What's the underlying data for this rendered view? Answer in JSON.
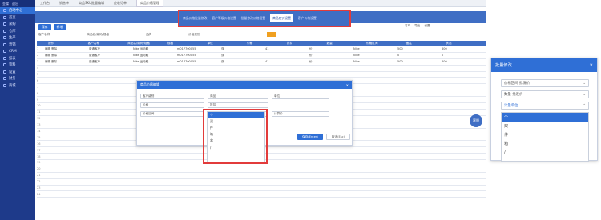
{
  "sidebar": {
    "top": [
      "金蝶",
      "退出"
    ],
    "items": [
      {
        "label": "启动中心",
        "active": true
      },
      {
        "label": "首页"
      },
      {
        "label": "采购"
      },
      {
        "label": "仓库"
      },
      {
        "label": "生产"
      },
      {
        "label": "营销"
      },
      {
        "label": "CRM"
      },
      {
        "label": "报表"
      },
      {
        "label": "资料"
      },
      {
        "label": "设置"
      },
      {
        "label": "财务"
      },
      {
        "label": "商城"
      }
    ]
  },
  "topbar": {
    "tabs": [
      "工作台",
      "销售单",
      "商品SKU批量编辑",
      "应收订单",
      "商品价格管理"
    ]
  },
  "highlight_tabs": {
    "tabs": [
      "商品价格批量修改",
      "客户等级价格设置",
      "批量修改价格设置",
      "商品定价设置",
      "客户价格设置"
    ]
  },
  "toolbar": {
    "btn1": "保存",
    "btn2": "新增"
  },
  "right_tools": [
    "打印",
    "导出",
    "设置"
  ],
  "filters": [
    "客户名称",
    "商品名/编码/规格",
    "品牌",
    "价格类别"
  ],
  "table": {
    "headers": [
      "操作",
      "客户名称",
      "商品名/编码/规格",
      "规格",
      "单位",
      "价格",
      "折扣",
      "数量",
      "价格区间",
      "备注",
      "状态"
    ],
    "rows": [
      [
        "编辑 删除",
        "普通客户",
        "Nike 运动鞋",
        "m017700055",
        "双",
        "41",
        "价",
        "Nike",
        "500",
        "600"
      ],
      [
        "编辑 删除",
        "普通客户",
        "Nike 运动鞋",
        "m017700055",
        "双",
        "",
        "价",
        "Nike",
        "0",
        "0"
      ],
      [
        "编辑 删除",
        "普通客户",
        "Nike 运动鞋",
        "m017700055",
        "双",
        "41",
        "价",
        "Nike",
        "500",
        "600"
      ]
    ]
  },
  "modal": {
    "title": "商品价格编辑",
    "f1": "客户级别",
    "f2": "商品",
    "f3": "单位",
    "f4": "价格",
    "f5": "折扣",
    "f6": "价格区间",
    "f7": "单价",
    "f8": "计算价",
    "dd_value": "计量单位",
    "ok": "保存(Enter)",
    "cancel": "取消(Esc)"
  },
  "dropdown": {
    "items": [
      "个",
      "双",
      "件",
      "箱",
      "盒",
      "/"
    ]
  },
  "chat": "客服",
  "panel": {
    "title": "批量修改",
    "f1": "价格区间",
    "f1_value": "批发价",
    "f2": "数量",
    "f2_value": "批发价",
    "f3_value": "计量单位",
    "dd_items": [
      "个",
      "双",
      "件",
      "箱",
      "/"
    ]
  }
}
